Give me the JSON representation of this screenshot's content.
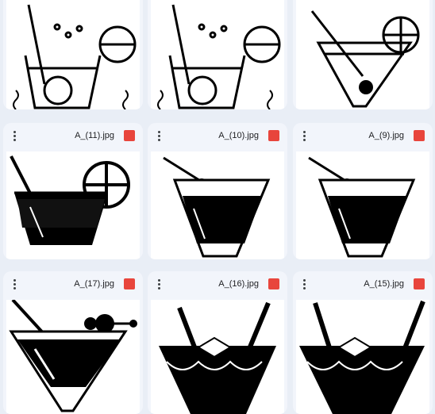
{
  "files": [
    {
      "name": ""
    },
    {
      "name": ""
    },
    {
      "name": ""
    },
    {
      "name": "A_(11).jpg"
    },
    {
      "name": "A_(10).jpg"
    },
    {
      "name": "A_(9).jpg"
    },
    {
      "name": "A_(17).jpg"
    },
    {
      "name": "A_(16).jpg"
    },
    {
      "name": "A_(15).jpg"
    }
  ],
  "icons": {
    "menu": "more-vert-icon",
    "filetype": "image-file-icon"
  },
  "colors": {
    "background": "#e9eef6",
    "card": "#f2f5fb",
    "image_badge": "#e8453c"
  }
}
